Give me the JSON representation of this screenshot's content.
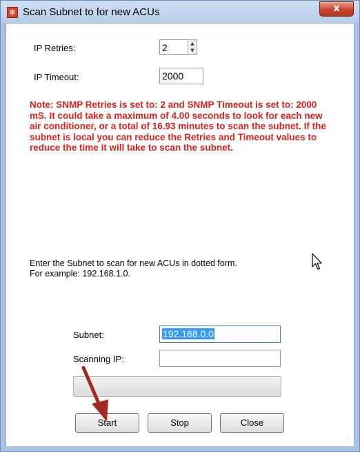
{
  "window": {
    "title": "Scan Subnet to for new ACUs",
    "close_glyph": "x",
    "app_icon": "snowflake-icon",
    "app_icon_glyph": "❄"
  },
  "retries": {
    "label": "IP Retries:",
    "value": "2"
  },
  "timeout": {
    "label": "IP Timeout:",
    "value": "2000"
  },
  "note": "Note: SNMP Retries is set to: 2 and SNMP Timeout is set to: 2000 mS. It could take a maximum of 4.00 seconds to look for each new air conditioner, or a total of 16.93 minutes to scan the subnet. If the subnet is local you can reduce the Retries and Timeout values to reduce the time it will take to scan the subnet.",
  "instructions": {
    "line1": "Enter the Subnet to scan for new ACUs in dotted form.",
    "line2": "For example: 192.168.1.0."
  },
  "subnet": {
    "label": "Subnet:",
    "value": "192.168.0.0"
  },
  "scanning": {
    "label": "Scanning IP:",
    "value": ""
  },
  "progress": 0,
  "buttons": {
    "start": "Start",
    "stop": "Stop",
    "close": "Close"
  },
  "colors": {
    "note_text": "#e0201c",
    "arrow": "#a12a22",
    "selection": "#3399ff"
  }
}
